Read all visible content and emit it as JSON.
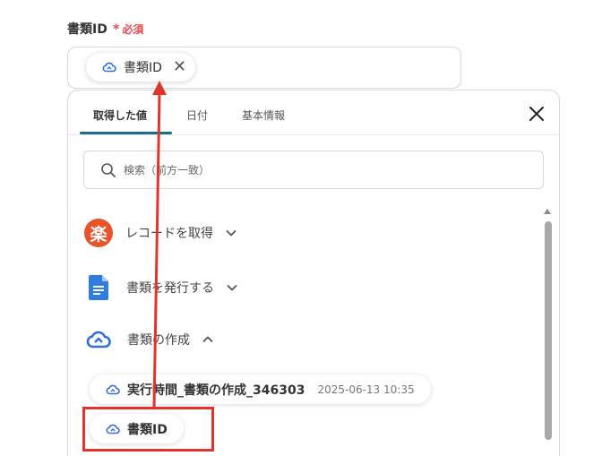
{
  "field": {
    "label": "書類ID",
    "required_label": "必須",
    "required_mark": "*"
  },
  "selected_chip": {
    "label": "書類ID",
    "icon": "cloud-sync-icon"
  },
  "tabs": [
    {
      "label": "取得した値",
      "active": true
    },
    {
      "label": "日付",
      "active": false
    },
    {
      "label": "基本情報",
      "active": false
    }
  ],
  "search": {
    "placeholder": "検索（前方一致）"
  },
  "sections": [
    {
      "label": "レコードを取得",
      "icon": "rakuten-icon",
      "icon_text": "楽",
      "expanded": false
    },
    {
      "label": "書類を発行する",
      "icon": "google-docs-icon",
      "expanded": false
    },
    {
      "label": "書類の作成",
      "icon": "cloud-sync-icon",
      "expanded": true
    }
  ],
  "outputs": [
    {
      "label": "実行時間_書類の作成_346303",
      "timestamp": "2025-06-13 10:35"
    },
    {
      "label": "書類ID",
      "timestamp": ""
    }
  ],
  "colors": {
    "accent": "#1f6b8a",
    "required": "#e8474f",
    "annotation": "#e0352b",
    "icon_blue": "#2f6fd6",
    "rakuten": "#e9532b"
  }
}
